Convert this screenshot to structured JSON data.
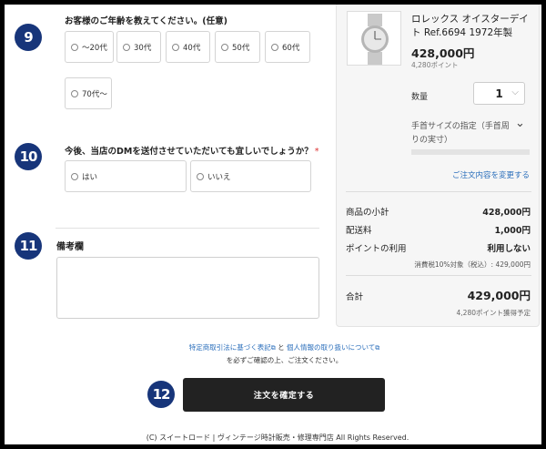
{
  "steps": {
    "step9": "9",
    "step10": "10",
    "step11": "11",
    "step12": "12"
  },
  "age_question": {
    "title": "お客様のご年齢を教えてください。(任意)",
    "options": [
      "～20代",
      "30代",
      "40代",
      "50代",
      "60代",
      "70代～"
    ]
  },
  "dm_question": {
    "title": "今後、当店のDMを送付させていただいても宜しいでしょうか？",
    "required_mark": "*",
    "options": [
      "はい",
      "いいえ"
    ]
  },
  "remarks": {
    "title": "備考欄"
  },
  "product": {
    "title": "ロレックス オイスターデイト Ref.6694 1972年製",
    "price": "428,000円",
    "points": "4,280ポイント",
    "quantity_label": "数量",
    "quantity": "1",
    "wrist_label": "手首サイズの指定（手首周りの実寸）",
    "change_link": "ご注文内容を変更する"
  },
  "summary": {
    "subtotal_label": "商品の小計",
    "subtotal_value": "428,000円",
    "shipping_label": "配送料",
    "shipping_value": "1,000円",
    "points_label": "ポイントの利用",
    "points_value": "利用しない",
    "tax_note": "消費税10%対象（税込）: 429,000円",
    "total_label": "合計",
    "total_value": "429,000円",
    "earn_note": "4,280ポイント獲得予定"
  },
  "terms": {
    "link1": "特定商取引法に基づく表記",
    "and": "と",
    "link2": "個人情報の取り扱いについて",
    "line2": "を必ずご確認の上、ご注文ください。"
  },
  "confirm_button": "注文を確定する",
  "footer": "(C) スイートロード | ヴィンテージ時計販売・修理専門店 All Rights Reserved.",
  "colors": {
    "step_badge": "#17357a",
    "link": "#2a6ebb",
    "button": "#222222",
    "required": "#dd3333"
  }
}
